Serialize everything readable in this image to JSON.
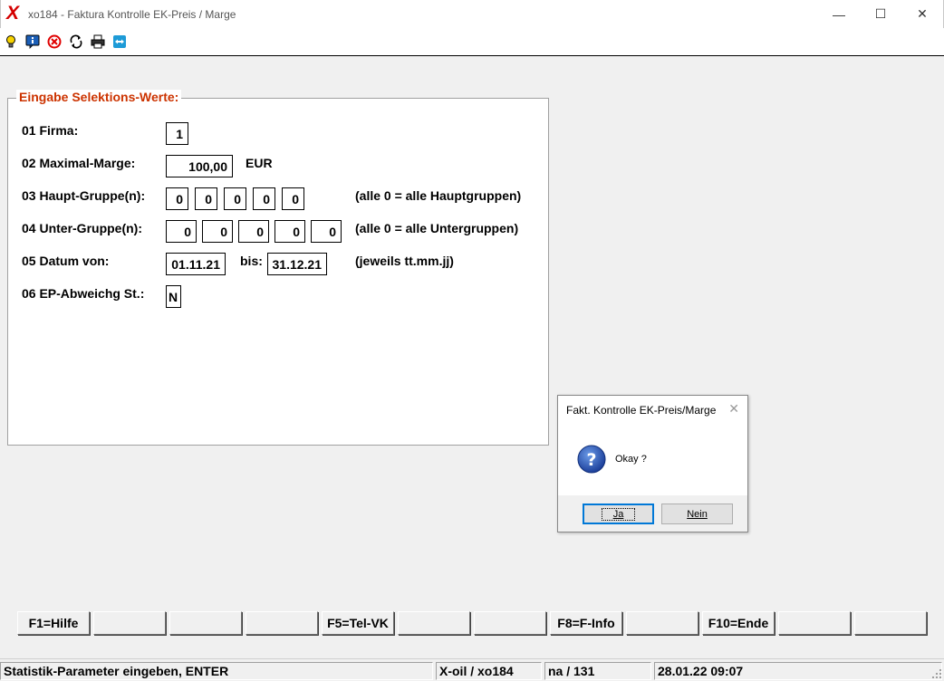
{
  "window": {
    "logo": "X",
    "title": "xo184 - Faktura Kontrolle EK-Preis / Marge",
    "minimize": "—",
    "maximize": "☐",
    "close": "✕"
  },
  "toolbar": {
    "icons": [
      "lightbulb-icon",
      "info-icon",
      "cancel-icon",
      "refresh-icon",
      "printer-icon",
      "teamviewer-icon"
    ]
  },
  "form": {
    "legend": "Eingabe Selektions-Werte:",
    "firma": {
      "label": "01 Firma:",
      "value": "1"
    },
    "marge": {
      "label": "02 Maximal-Marge:",
      "value": "100,00",
      "unit": "EUR"
    },
    "haupt": {
      "label": "03 Haupt-Gruppe(n):",
      "values": [
        "0",
        "0",
        "0",
        "0",
        "0"
      ],
      "hint": "(alle 0 = alle Hauptgruppen)"
    },
    "unter": {
      "label": "04 Unter-Gruppe(n):",
      "values": [
        "0",
        "0",
        "0",
        "0",
        "0"
      ],
      "hint": "(alle 0 = alle Untergruppen)"
    },
    "datum": {
      "label": "05 Datum von:",
      "von": "01.11.21",
      "bis_label": "bis:",
      "bis": "31.12.21",
      "hint": "(jeweils tt.mm.jj)"
    },
    "ep": {
      "label": "06 EP-Abweichg St.:",
      "value": "N"
    }
  },
  "dialog": {
    "title": "Fakt. Kontrolle EK-Preis/Marge",
    "close": "✕",
    "message": "Okay ?",
    "yes": "Ja",
    "no": "Nein"
  },
  "fkeys": [
    "F1=Hilfe",
    "",
    "",
    "",
    "F5=Tel-VK",
    "",
    "",
    "F8=F-Info",
    "",
    "F10=Ende",
    "",
    ""
  ],
  "status": {
    "message": "Statistik-Parameter eingeben, ENTER",
    "module": "X-oil / xo184",
    "user": "na / 131",
    "datetime": "28.01.22 09:07"
  }
}
